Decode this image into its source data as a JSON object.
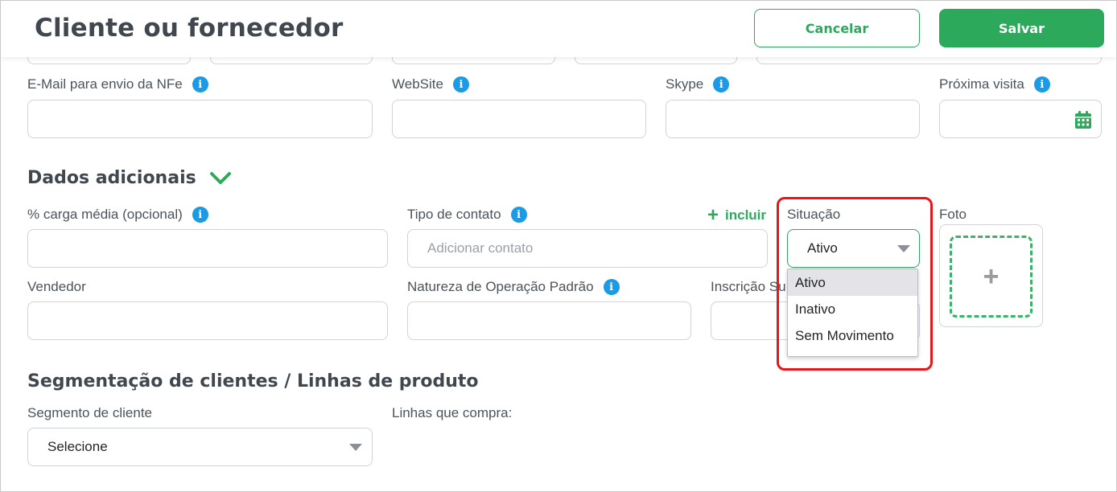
{
  "header": {
    "title": "Cliente ou fornecedor",
    "cancel_label": "Cancelar",
    "save_label": "Salvar"
  },
  "fields": {
    "email_nfe": {
      "label": "E-Mail para envio da NFe"
    },
    "website": {
      "label": "WebSite"
    },
    "skype": {
      "label": "Skype"
    },
    "proxima_visita": {
      "label": "Próxima visita"
    },
    "carga_media": {
      "label": "% carga média (opcional)"
    },
    "tipo_contato": {
      "label": "Tipo de contato",
      "placeholder": "Adicionar contato"
    },
    "incluir_label": "incluir",
    "situacao": {
      "label": "Situação",
      "value": "Ativo",
      "options": [
        "Ativo",
        "Inativo",
        "Sem Movimento"
      ],
      "selected_index": 0
    },
    "foto": {
      "label": "Foto"
    },
    "vendedor": {
      "label": "Vendedor"
    },
    "natureza_operacao": {
      "label": "Natureza de Operação Padrão"
    },
    "inscricao_suframa": {
      "label": "Inscrição Su"
    },
    "segmento_cliente": {
      "label": "Segmento de cliente",
      "value": "Selecione"
    },
    "linhas_compra": {
      "label": "Linhas que compra:"
    }
  },
  "sections": {
    "dados_adicionais": "Dados adicionais",
    "segmentacao": "Segmentação de clientes / Linhas de produto"
  },
  "icons": {
    "info": "info-icon",
    "chevron": "chevron-down-icon",
    "calendar": "calendar-icon",
    "plus": "plus-icon"
  },
  "colors": {
    "accent_green": "#2da95c",
    "info_blue": "#1b9be6",
    "highlight_red": "#e8151b"
  }
}
